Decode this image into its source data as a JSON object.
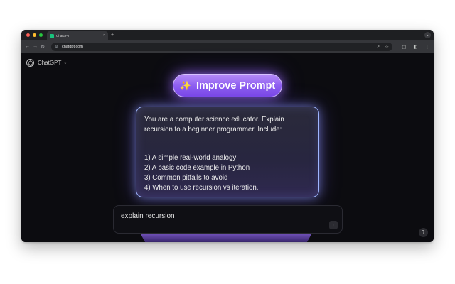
{
  "browser": {
    "tab_title": "ChatGPT",
    "tab_close": "×",
    "new_tab": "+",
    "url": "chatgpt.com",
    "icons": [
      "back-icon",
      "forward-icon",
      "reload-icon",
      "site-settings-icon",
      "zoom-icon",
      "bookmark-star-icon",
      "extensions-icon",
      "side-panel-icon",
      "more-menu-icon"
    ]
  },
  "header": {
    "app_name": "ChatGPT",
    "model_caret": "⌄"
  },
  "improve_button": {
    "emoji": "✨",
    "label": "Improve Prompt"
  },
  "prompt_card": {
    "intro_lines": [
      "You are a computer science educator. Explain",
      "recursion to a beginner programmer. Include:"
    ],
    "items": [
      "1) A simple real-world analogy",
      "2) A basic code example in Python",
      "3) Common pitfalls to avoid",
      "4) When to use recursion vs iteration."
    ]
  },
  "chat_input": {
    "value": "explain recursion"
  },
  "help_button": {
    "label": "?"
  },
  "colors": {
    "page_bg": "#0c0c10",
    "accent_purple": "#8c5cf0",
    "card_border": "#9fb6ff"
  }
}
